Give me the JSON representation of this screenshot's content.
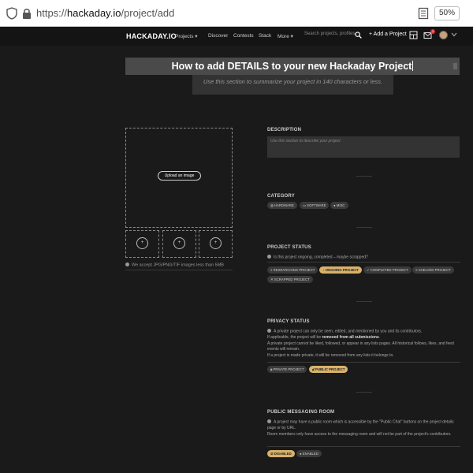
{
  "browser": {
    "url_prefix": "https://",
    "url_domain": "hackaday.io",
    "url_path": "/project/add",
    "zoom": "50%"
  },
  "nav": {
    "logo": "HACKADAY.IO",
    "items": [
      "Projects",
      "Discover",
      "Contests",
      "Stack",
      "More"
    ],
    "search_placeholder": "Search projects, profiles",
    "add_project": "+ Add a Project",
    "notification_count": "1"
  },
  "title": {
    "value": "How to add DETAILS to your new Hackaday Project"
  },
  "summary": {
    "placeholder": "Use this section to summarize your project in 140 characters or less."
  },
  "uploader": {
    "button": "Upload an image",
    "thumb_add": "+",
    "note": "We accept JPG/PNG/TIF images less than 5MB"
  },
  "description": {
    "label": "DESCRIPTION",
    "placeholder": "Use this section to describe your project"
  },
  "category": {
    "label": "CATEGORY",
    "options": [
      "HARDWARE",
      "SOFTWARE",
      "MISC"
    ]
  },
  "project_status": {
    "label": "PROJECT STATUS",
    "hint": "Is this project ongoing, completed – maybe scrapped?",
    "options": [
      "RESEARCHING PROJECT",
      "ONGOING PROJECT",
      "COMPLETED PROJECT",
      "SHELVED PROJECT",
      "SCRAPPED PROJECT"
    ],
    "selected": "ONGOING PROJECT"
  },
  "privacy_status": {
    "label": "PRIVACY STATUS",
    "line1": "A private project can only be seen, edited, and mentioned by you and its contributors.",
    "line2a": "If applicable, the project will be",
    "line2b": "removed from all submissions",
    "line3": "A private project cannot be liked, followed, or appear in any lists pages. All historical follows, likes, and feed events will remain.",
    "line4": "If a project is made private, it will be removed from any lists it belongs to.",
    "options": [
      "PRIVATE PROJECT",
      "PUBLIC PROJECT"
    ],
    "selected": "PUBLIC PROJECT"
  },
  "messaging": {
    "label": "PUBLIC MESSAGING ROOM",
    "line1": "A project may have a public room which is accessible by the \"Public Chat\" buttons on the project details page or by URL.",
    "line2": "Room members only have access to the messaging room and will not be part of the project's contributors.",
    "options": [
      "DISABLED",
      "ENABLED"
    ],
    "selected": "DISABLED"
  }
}
